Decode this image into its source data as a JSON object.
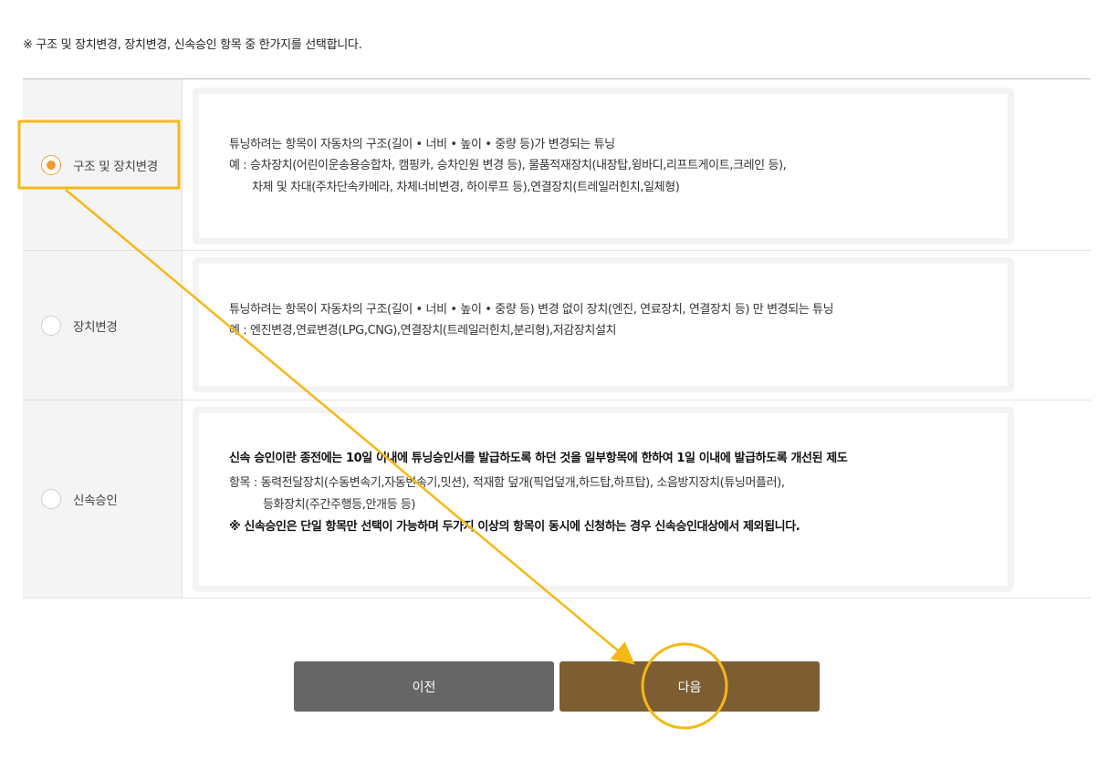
{
  "notice": "※ 구조 및 장치변경, 장치변경, 신속승인 항목 중 한가지를 선택합니다.",
  "options": [
    {
      "label": "구조 및 장치변경",
      "selected": true,
      "description": "튜닝하려는 항목이 자동차의 구조(길이 • 너비 • 높이 • 중량 등)가 변경되는 튜닝",
      "example_line1": "예 : 승차장치(어린이운송용승합차, 캠핑카, 승차인원 변경 등), 물품적재장치(내장탑,윙바디,리프트게이트,크레인 등),",
      "example_line2": "차체 및 차대(주차단속카메라, 차체너비변경, 하이루프 등),연결장치(트레일러힌치,일체형)"
    },
    {
      "label": "장치변경",
      "selected": false,
      "description": "튜닝하려는 항목이 자동차의 구조(길이 • 너비 • 높이 • 중량 등) 변경 없이 장치(엔진, 연료장치, 연결장치 등) 만 변경되는 튜닝",
      "example_line1": "예 : 엔진변경,연료변경(LPG,CNG),연결장치(트레일러힌치,분리형),저감장치설치"
    },
    {
      "label": "신속승인",
      "selected": false,
      "description": "신속 승인이란 종전에는 10일 이내에 튜닝승인서를 발급하도록 하던 것을 일부항목에 한하여 1일 이내에 발급하도록 개선된 제도",
      "item_line1": "항목 : 동력전달장치(수동변속기,자동변속기,밋션), 적재함 덮개(픽업덮개,하드탑,하프탑), 소음방지장치(튜닝머플러),",
      "item_line2": "등화장치(주간주행등,안개등 등)",
      "warning": "※ 신속승인은 단일 항목만 선택이 가능하며 두가지 이상의 항목이 동시에 신청하는 경우 신속승인대상에서 제외됩니다."
    }
  ],
  "buttons": {
    "prev": "이전",
    "next": "다음"
  },
  "colors": {
    "highlight": "#f5b914",
    "radio_selected": "#f29a2e",
    "prev_button": "#666666",
    "next_button": "#7d5e33"
  }
}
